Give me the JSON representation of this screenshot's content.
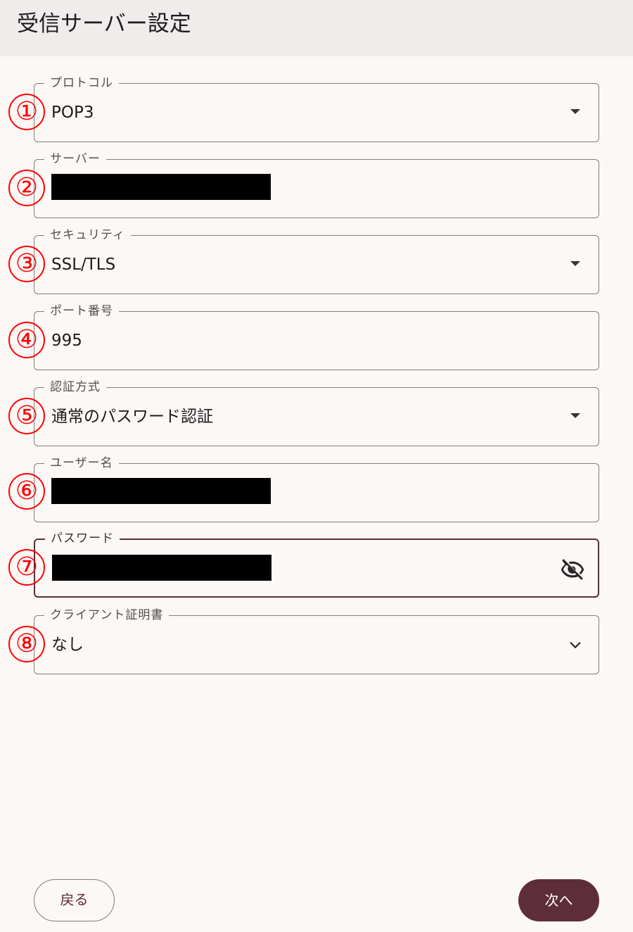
{
  "header": {
    "title": "受信サーバー設定"
  },
  "fields": [
    {
      "label": "プロトコル",
      "value": "POP3",
      "control": "dropdown",
      "marker": "1"
    },
    {
      "label": "サーバー",
      "value": "",
      "redacted": true,
      "marker": "2"
    },
    {
      "label": "セキュリティ",
      "value": "SSL/TLS",
      "control": "dropdown",
      "marker": "3"
    },
    {
      "label": "ポート番号",
      "value": "995",
      "marker": "4"
    },
    {
      "label": "認証方式",
      "value": "通常のパスワード認証",
      "control": "dropdown",
      "marker": "5"
    },
    {
      "label": "ユーザー名",
      "value": "",
      "redacted": true,
      "marker": "6"
    },
    {
      "label": "パスワード",
      "value": "",
      "redacted": true,
      "focused": true,
      "icon": "visibility-off-icon",
      "marker": "7"
    },
    {
      "label": "クライアント証明書",
      "value": "なし",
      "control": "chevron-dropdown",
      "marker": "8"
    }
  ],
  "markers": [
    "①",
    "②",
    "③",
    "④",
    "⑤",
    "⑥",
    "⑦",
    "⑧"
  ],
  "buttons": {
    "back": "戻る",
    "next": "次へ"
  },
  "colors": {
    "accent": "#5e2d3a",
    "header_bg": "#efeceb",
    "background": "#fcf8f6",
    "outline": "#857c7e",
    "marker_red": "#ff0000"
  }
}
